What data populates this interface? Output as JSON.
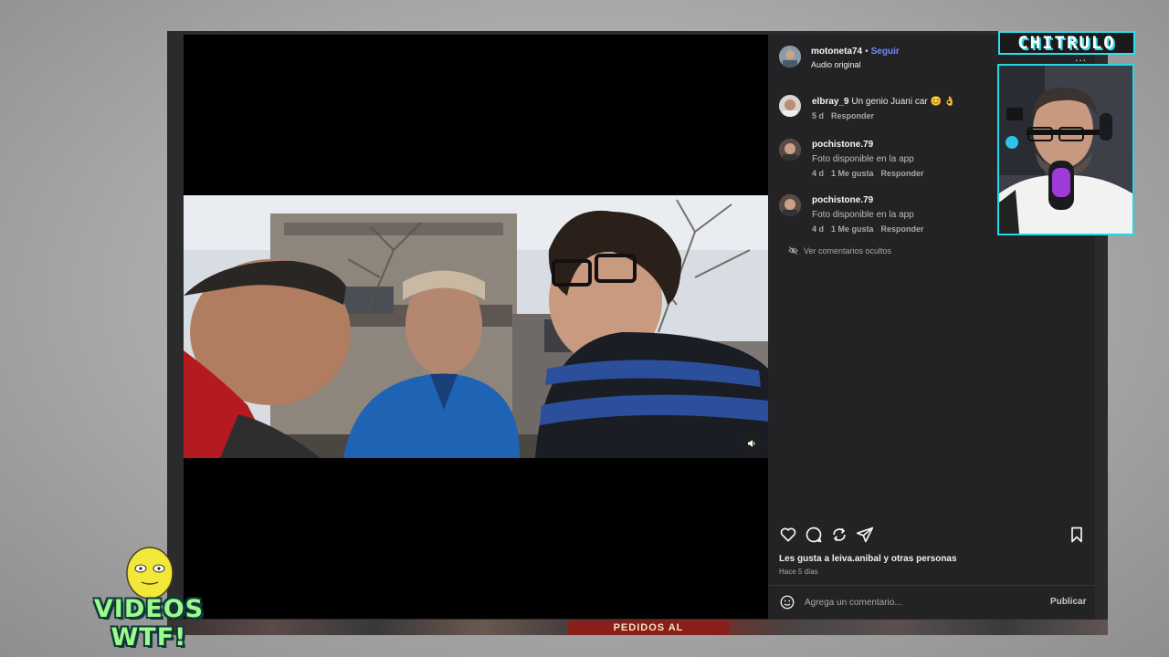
{
  "overlay": {
    "channel_logo": "CHITRULO",
    "show_logo": "VIDEOS WTF!",
    "strip_label": "PEDIDOS AL",
    "more_dots": "..."
  },
  "post": {
    "username": "motoneta74",
    "dot": "•",
    "follow_label": "Seguir",
    "audio": "Audio original"
  },
  "comments": [
    {
      "username": "elbray_9",
      "text": "Un genio Juani car 😊 👌",
      "time": "5 d",
      "likes": "",
      "reply": "Responder"
    },
    {
      "username": "pochistone.79",
      "text": "Foto disponible en la app",
      "time": "4 d",
      "likes": "1 Me gusta",
      "reply": "Responder"
    },
    {
      "username": "pochistone.79",
      "text": "Foto disponible en la app",
      "time": "4 d",
      "likes": "1 Me gusta",
      "reply": "Responder"
    }
  ],
  "hidden_comments_label": "Ver comentarios ocultos",
  "likes": {
    "prefix": "Les gusta a ",
    "user": "leiva.anibal",
    "suffix": " y otras personas",
    "time": "Hace 5 días"
  },
  "composer": {
    "placeholder": "Agrega un comentario...",
    "publish_label": "Publicar"
  },
  "colors": {
    "follow": "#6d8cff",
    "webcam_border": "#1fd8e8",
    "wtf_text": "#9dfa8c"
  }
}
